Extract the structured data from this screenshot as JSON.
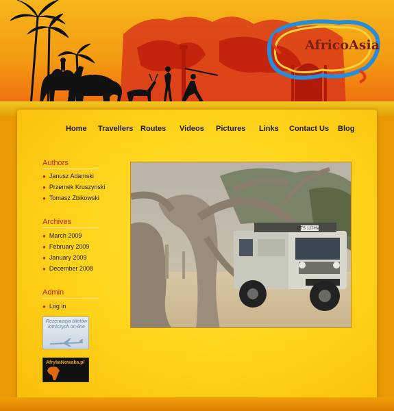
{
  "logo": {
    "text": "AfricoAsia"
  },
  "nav": {
    "items": [
      {
        "label": "Home"
      },
      {
        "label": "Travellers"
      },
      {
        "label": "Routes"
      },
      {
        "label": "Videos"
      },
      {
        "label": "Pictures"
      },
      {
        "label": "Links"
      },
      {
        "label": "Contact Us"
      },
      {
        "label": "Blog"
      }
    ]
  },
  "sidebar": {
    "authors": {
      "title": "Authors",
      "items": [
        {
          "label": "Janusz Adamski"
        },
        {
          "label": "Przemek Kruszynski"
        },
        {
          "label": "Tomasz Zbikowski"
        }
      ]
    },
    "archives": {
      "title": "Archives",
      "items": [
        {
          "label": "March 2009"
        },
        {
          "label": "February 2009"
        },
        {
          "label": "January 2009"
        },
        {
          "label": "December 2008"
        }
      ]
    },
    "admin": {
      "title": "Admin",
      "items": [
        {
          "label": "Log in"
        }
      ]
    }
  },
  "badges": {
    "flights": "Rezerwacja biletów lotniczych on-line",
    "africa": "AfrykaNowaka.pl"
  },
  "photo": {
    "plate": "DTS 127HV"
  },
  "colors": {
    "accent_red": "#c0200c",
    "panel_yellow": "#ffd21a",
    "background_orange": "#e89a00"
  }
}
